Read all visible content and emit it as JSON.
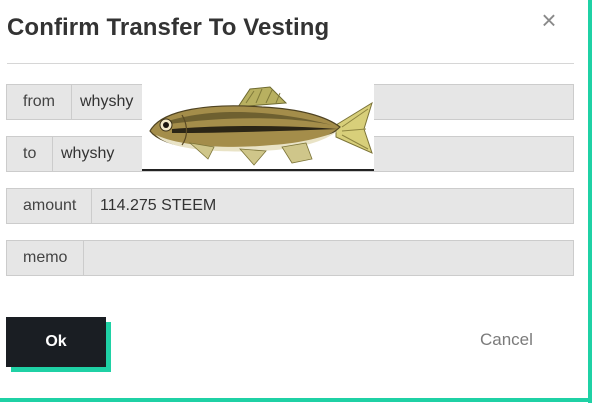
{
  "dialog": {
    "title": "Confirm Transfer To Vesting",
    "close_glyph": "×",
    "accent_color": "#1fd1a5"
  },
  "form": {
    "from_label": "from",
    "from_value": "whyshy",
    "to_label": "to",
    "to_value": "whyshy",
    "amount_label": "amount",
    "amount_value": "114.275 STEEM",
    "memo_label": "memo",
    "memo_value": ""
  },
  "buttons": {
    "ok_label": "Ok",
    "cancel_label": "Cancel"
  },
  "overlay": {
    "image_name": "minnow-fish-image"
  }
}
